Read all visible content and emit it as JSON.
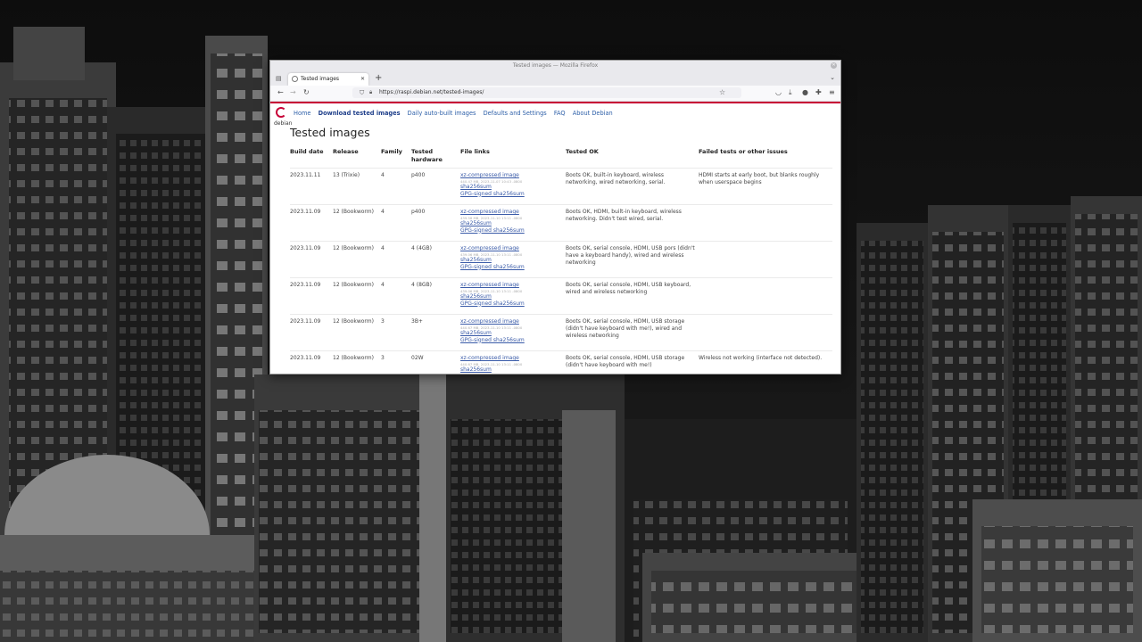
{
  "window": {
    "title": "Tested images — Mozilla Firefox",
    "tab_title": "Tested images",
    "new_tab_label": "+",
    "url": "https://raspi.debian.net/tested-images/"
  },
  "site": {
    "logo_text": "debian",
    "nav": [
      "Home",
      "Download tested images",
      "Daily auto-built images",
      "Defaults and Settings",
      "FAQ",
      "About Debian"
    ],
    "heading": "Tested images"
  },
  "table": {
    "headers": [
      "Build date",
      "Release",
      "Family",
      "Tested hardware",
      "File links",
      "Tested OK",
      "Failed tests or other issues"
    ],
    "rows": [
      {
        "date": "2023.11.11",
        "release": "13 (Trixie)",
        "family": "4",
        "hardware": "p400",
        "link_image": "xz-compressed image",
        "size": "440.47 MB, 2023-11-07 10:43 -0800",
        "link_sha": "sha256sum",
        "link_gpg": "GPG-signed sha256sum",
        "ok": "Boots OK, built-in keyboard, wireless networking, wired networking, serial.",
        "issues": "HDMI starts at early boot, but blanks roughly when userspace begins"
      },
      {
        "date": "2023.11.09",
        "release": "12 (Bookworm)",
        "family": "4",
        "hardware": "p400",
        "link_image": "xz-compressed image",
        "size": "439.58 MB, 2023-11-10 13:11 -0800",
        "link_sha": "sha256sum",
        "link_gpg": "GPG-signed sha256sum",
        "ok": "Boots OK, HDMI, built-in keyboard, wireless networking. Didn't test wired, serial.",
        "issues": ""
      },
      {
        "date": "2023.11.09",
        "release": "12 (Bookworm)",
        "family": "4",
        "hardware": "4 (4GB)",
        "link_image": "xz-compressed image",
        "size": "439.06 MB, 2023-11-10 13:11 -0800",
        "link_sha": "sha256sum",
        "link_gpg": "GPG-signed sha256sum",
        "ok": "Boots OK, serial console, HDMI, USB pors (didn't have a keyboard handy), wired and wireless networking",
        "issues": ""
      },
      {
        "date": "2023.11.09",
        "release": "12 (Bookworm)",
        "family": "4",
        "hardware": "4 (8GB)",
        "link_image": "xz-compressed image",
        "size": "439.06 MB, 2023-11-10 13:11 -0800",
        "link_sha": "sha256sum",
        "link_gpg": "GPG-signed sha256sum",
        "ok": "Boots OK, serial console, HDMI, USB keyboard, wired and wireless networking",
        "issues": ""
      },
      {
        "date": "2023.11.09",
        "release": "12 (Bookworm)",
        "family": "3",
        "hardware": "3B+",
        "link_image": "xz-compressed image",
        "size": "440.67 MB, 2023-11-10 13:11 -0800",
        "link_sha": "sha256sum",
        "link_gpg": "GPG-signed sha256sum",
        "ok": "Boots OK, serial console, HDMI, USB storage (didn't have keyboard with me!), wired and wireless networking",
        "issues": ""
      },
      {
        "date": "2023.11.09",
        "release": "12 (Bookworm)",
        "family": "3",
        "hardware": "02W",
        "link_image": "xz-compressed image",
        "size": "440.67 MB, 2023-11-10 13:11 -0800",
        "link_sha": "sha256sum",
        "link_gpg": "GPG-signed sha256sum",
        "ok": "Boots OK, serial console, HDMI, USB storage (didn't have keyboard with me!)",
        "issues": "Wireless not working (interface not detected)."
      }
    ]
  },
  "colors": {
    "debian_red": "#c70036",
    "link": "#3a5ba8"
  },
  "icons": [
    "tab-list-icon",
    "back-icon",
    "forward-icon",
    "reload-icon",
    "shield-icon",
    "lock-icon",
    "bookmark-star-icon",
    "pocket-icon",
    "download-icon",
    "account-icon",
    "extensions-icon",
    "menu-icon"
  ]
}
